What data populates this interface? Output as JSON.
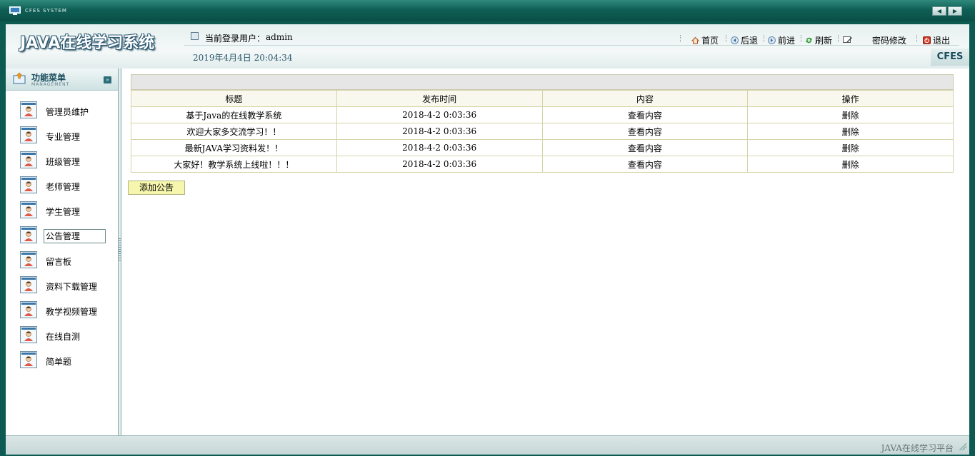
{
  "window": {
    "title": "CFES SYSTEM",
    "btn_prev": "◀",
    "btn_next": "▶"
  },
  "header": {
    "logo": "JAVA在线学习系统",
    "user_label": "当前登录用户：",
    "user_name": "admin",
    "datetime": "2019年4月4日  20:04:34",
    "brand": "CFES",
    "links": {
      "home": "首页",
      "back": "后退",
      "forward": "前进",
      "refresh": "刷新",
      "password": "密码修改",
      "logout": "退出"
    }
  },
  "sidebar": {
    "title": "功能菜单",
    "subtitle": "MANAGEMENT",
    "collapse_icon": "»",
    "items": [
      {
        "label": "管理员维护"
      },
      {
        "label": "专业管理"
      },
      {
        "label": "班级管理"
      },
      {
        "label": "老师管理"
      },
      {
        "label": "学生管理"
      },
      {
        "label": "公告管理"
      },
      {
        "label": "留言板"
      },
      {
        "label": "资料下载管理"
      },
      {
        "label": "教学视频管理"
      },
      {
        "label": "在线自测"
      },
      {
        "label": "简单题"
      }
    ]
  },
  "table": {
    "headers": [
      "标题",
      "发布时间",
      "内容",
      "操作"
    ],
    "rows": [
      {
        "title": "基于Java的在线教学系统",
        "time": "2018-4-2 0:03:36",
        "content": "查看内容",
        "action": "删除"
      },
      {
        "title": "欢迎大家多交流学习！！",
        "time": "2018-4-2 0:03:36",
        "content": "查看内容",
        "action": "删除"
      },
      {
        "title": "最新JAVA学习资料发！！",
        "time": "2018-4-2 0:03:36",
        "content": "查看内容",
        "action": "删除"
      },
      {
        "title": "大家好！教学系统上线啦！！！",
        "time": "2018-4-2 0:03:36",
        "content": "查看内容",
        "action": "删除"
      }
    ]
  },
  "add_button": "添加公告",
  "footer": {
    "text": "JAVA在线学习平台"
  }
}
